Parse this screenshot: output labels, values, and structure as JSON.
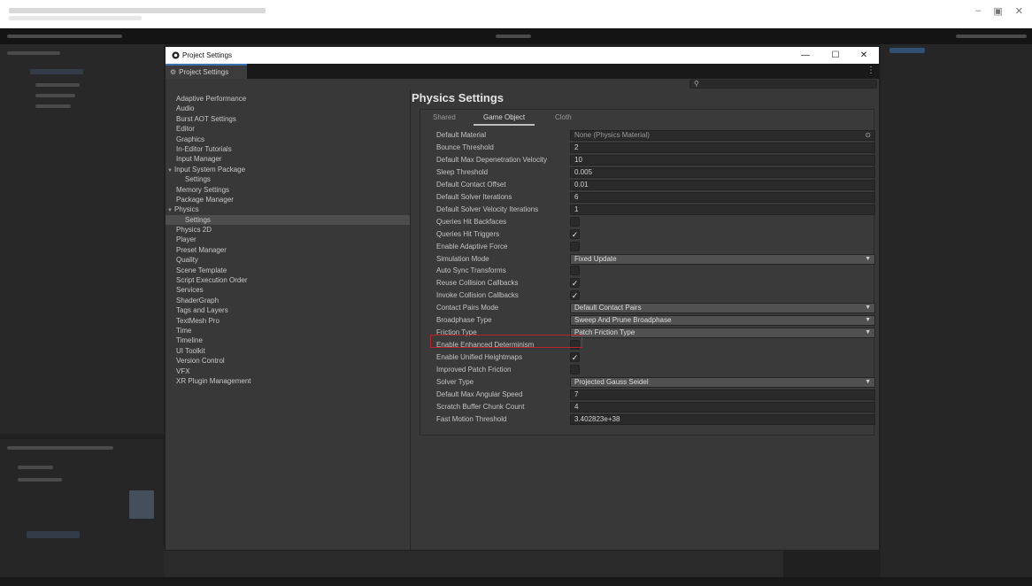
{
  "window": {
    "title": "Project Settings",
    "tab_label": "Project Settings",
    "minimize": "—",
    "maximize": "☐",
    "close": "✕",
    "tab_menu": "⋮"
  },
  "search": {
    "placeholder": "",
    "icon": "search-icon"
  },
  "sidebar": {
    "items": [
      {
        "label": "Adaptive Performance",
        "level": 0
      },
      {
        "label": "Audio",
        "level": 0
      },
      {
        "label": "Burst AOT Settings",
        "level": 0
      },
      {
        "label": "Editor",
        "level": 0
      },
      {
        "label": "Graphics",
        "level": 0
      },
      {
        "label": "In-Editor Tutorials",
        "level": 0
      },
      {
        "label": "Input Manager",
        "level": 0
      },
      {
        "label": "Input System Package",
        "level": 0,
        "group": true
      },
      {
        "label": "Settings",
        "level": 1
      },
      {
        "label": "Memory Settings",
        "level": 0
      },
      {
        "label": "Package Manager",
        "level": 0
      },
      {
        "label": "Physics",
        "level": 0,
        "group": true
      },
      {
        "label": "Settings",
        "level": 1,
        "selected": true
      },
      {
        "label": "Physics 2D",
        "level": 0
      },
      {
        "label": "Player",
        "level": 0
      },
      {
        "label": "Preset Manager",
        "level": 0
      },
      {
        "label": "Quality",
        "level": 0
      },
      {
        "label": "Scene Template",
        "level": 0
      },
      {
        "label": "Script Execution Order",
        "level": 0
      },
      {
        "label": "Services",
        "level": 0
      },
      {
        "label": "ShaderGraph",
        "level": 0
      },
      {
        "label": "Tags and Layers",
        "level": 0
      },
      {
        "label": "TextMesh Pro",
        "level": 0
      },
      {
        "label": "Time",
        "level": 0
      },
      {
        "label": "Timeline",
        "level": 0
      },
      {
        "label": "UI Toolkit",
        "level": 0
      },
      {
        "label": "Version Control",
        "level": 0
      },
      {
        "label": "VFX",
        "level": 0
      },
      {
        "label": "XR Plugin Management",
        "level": 0
      }
    ]
  },
  "main": {
    "title": "Physics Settings",
    "tabs": [
      {
        "label": "Shared",
        "active": false
      },
      {
        "label": "Game Object",
        "active": true
      },
      {
        "label": "Cloth",
        "active": false
      }
    ],
    "properties": [
      {
        "label": "Default Material",
        "type": "object",
        "value": "None (Physics Material)"
      },
      {
        "label": "Bounce Threshold",
        "type": "text",
        "value": "2"
      },
      {
        "label": "Default Max Depenetration Velocity",
        "type": "text",
        "value": "10"
      },
      {
        "label": "Sleep Threshold",
        "type": "text",
        "value": "0.005"
      },
      {
        "label": "Default Contact Offset",
        "type": "text",
        "value": "0.01"
      },
      {
        "label": "Default Solver Iterations",
        "type": "text",
        "value": "6"
      },
      {
        "label": "Default Solver Velocity Iterations",
        "type": "text",
        "value": "1"
      },
      {
        "label": "Queries Hit Backfaces",
        "type": "checkbox",
        "checked": false
      },
      {
        "label": "Queries Hit Triggers",
        "type": "checkbox",
        "checked": true
      },
      {
        "label": "Enable Adaptive Force",
        "type": "checkbox",
        "checked": false
      },
      {
        "label": "Simulation Mode",
        "type": "dropdown",
        "value": "Fixed Update"
      },
      {
        "label": "Auto Sync Transforms",
        "type": "checkbox",
        "checked": false,
        "highlighted": true
      },
      {
        "label": "Reuse Collision Callbacks",
        "type": "checkbox",
        "checked": true
      },
      {
        "label": "Invoke Collision Callbacks",
        "type": "checkbox",
        "checked": true
      },
      {
        "label": "Contact Pairs Mode",
        "type": "dropdown",
        "value": "Default Contact Pairs"
      },
      {
        "label": "Broadphase Type",
        "type": "dropdown",
        "value": "Sweep And Prune Broadphase"
      },
      {
        "label": "Friction Type",
        "type": "dropdown",
        "value": "Patch Friction Type"
      },
      {
        "label": "Enable Enhanced Determinism",
        "type": "checkbox",
        "checked": false
      },
      {
        "label": "Enable Unified Heightmaps",
        "type": "checkbox",
        "checked": true
      },
      {
        "label": "Improved Patch Friction",
        "type": "checkbox",
        "checked": false
      },
      {
        "label": "Solver Type",
        "type": "dropdown",
        "value": "Projected Gauss Seidel"
      },
      {
        "label": "Default Max Angular Speed",
        "type": "text",
        "value": "7"
      },
      {
        "label": "Scratch Buffer Chunk Count",
        "type": "text",
        "value": "4"
      },
      {
        "label": "Fast Motion Threshold",
        "type": "text",
        "value": "3.402823e+38"
      }
    ]
  },
  "colors": {
    "window_bg": "#383838",
    "field_bg": "#2a2a2a",
    "dropdown_bg": "#515151",
    "highlight_border": "#b8242c",
    "tab_accent": "#3a72b0"
  }
}
